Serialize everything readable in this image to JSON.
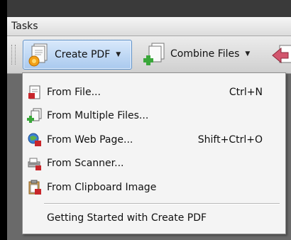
{
  "panel": {
    "title": "Tasks"
  },
  "toolbar": {
    "create_pdf": {
      "label": "Create PDF",
      "icon": "create-pdf-icon",
      "arrow": "▼"
    },
    "combine_files": {
      "label": "Combine Files",
      "icon": "combine-files-icon",
      "arrow": "▼"
    },
    "partial_icon": "export-icon"
  },
  "menu": {
    "items": [
      {
        "label": "From File...",
        "shortcut": "Ctrl+N",
        "icon": "file-pdf-icon"
      },
      {
        "label": "From Multiple Files...",
        "shortcut": "",
        "icon": "multiple-files-icon"
      },
      {
        "label": "From Web Page...",
        "shortcut": "Shift+Ctrl+O",
        "icon": "web-page-icon"
      },
      {
        "label": "From Scanner...",
        "shortcut": "",
        "icon": "scanner-icon"
      },
      {
        "label": "From Clipboard Image",
        "shortcut": "",
        "icon": "clipboard-icon"
      }
    ],
    "footer": {
      "label": "Getting Started with Create PDF"
    }
  },
  "colors": {
    "accent_border": "#5b8fc7",
    "accent_fill": "#a9c9ee",
    "pdf_red": "#c8262b",
    "plus_green": "#3aa73a"
  }
}
